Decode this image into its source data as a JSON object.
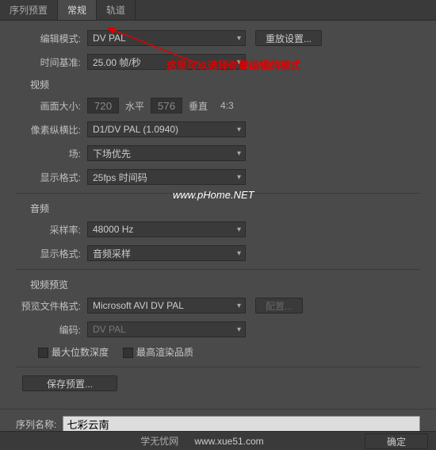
{
  "tabs": {
    "preset": "序列预置",
    "general": "常规",
    "tracks": "轨道"
  },
  "editMode": {
    "label": "编辑模式:",
    "value": "DV PAL"
  },
  "resetBtn": "重放设置...",
  "timebase": {
    "label": "时间基准:",
    "value": "25.00 帧/秒"
  },
  "video": {
    "title": "视频",
    "frameSize": {
      "label": "画面大小:",
      "width": "720",
      "hLabel": "水平",
      "height": "576",
      "vLabel": "垂直",
      "aspect": "4:3"
    },
    "par": {
      "label": "像素纵横比:",
      "value": "D1/DV PAL (1.0940)"
    },
    "field": {
      "label": "场:",
      "value": "下场优先"
    },
    "displayFmt": {
      "label": "显示格式:",
      "value": "25fps 时间码"
    }
  },
  "audio": {
    "title": "音频",
    "sampleRate": {
      "label": "采样率:",
      "value": "48000 Hz"
    },
    "displayFmt": {
      "label": "显示格式:",
      "value": "音频采样"
    }
  },
  "preview": {
    "title": "视频预览",
    "fileFmt": {
      "label": "预览文件格式:",
      "value": "Microsoft AVI DV PAL"
    },
    "codec": {
      "label": "编码:",
      "value": "DV PAL"
    },
    "configBtn": "配置...",
    "maxBit": "最大位数深度",
    "maxQuality": "最高渲染品质"
  },
  "savePresetBtn": "保存预置...",
  "seqName": {
    "label": "序列名称:",
    "value": "七彩云南"
  },
  "footer": {
    "text": "学无忧网",
    "link": "www.xue51.com",
    "ok": "确定"
  },
  "annotation": "这里可以选择你要编辑的模式",
  "watermark": "www.pHome.NET"
}
